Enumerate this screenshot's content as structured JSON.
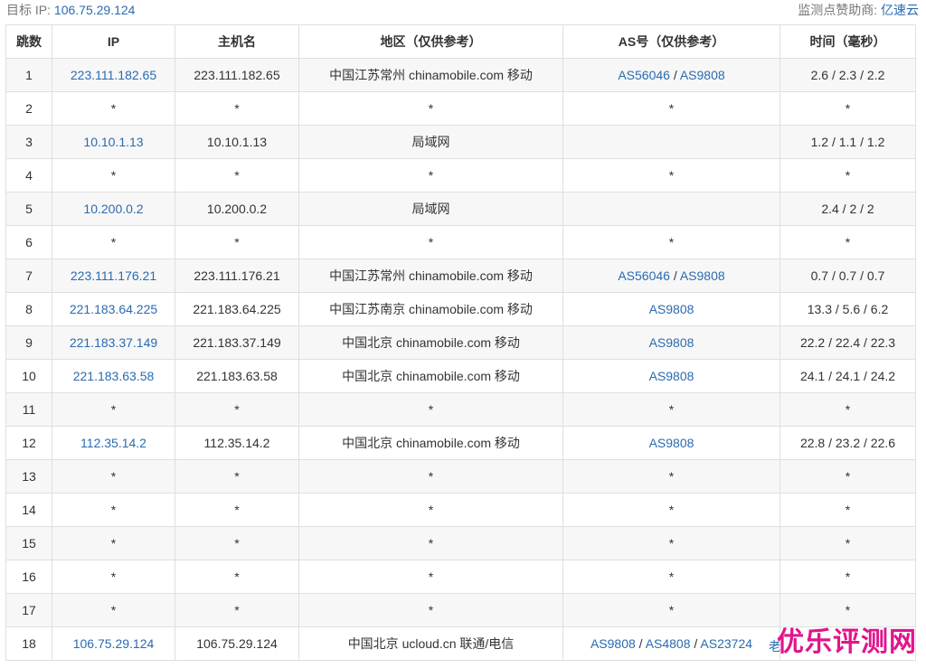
{
  "header": {
    "target_label": "目标 IP:",
    "target_ip": "106.75.29.124",
    "sponsor_label": "监测点赞助商:",
    "sponsor_name": "亿速云"
  },
  "table": {
    "columns": [
      "跳数",
      "IP",
      "主机名",
      "地区（仅供参考）",
      "AS号（仅供参考）",
      "时间（毫秒）"
    ],
    "rows": [
      {
        "hop": "1",
        "ip": "223.111.182.65",
        "host": "223.111.182.65",
        "region": "中国江苏常州 chinamobile.com 移动",
        "as": [
          "AS56046",
          "AS9808"
        ],
        "time": "2.6 / 2.3 / 2.2"
      },
      {
        "hop": "2",
        "ip": "*",
        "host": "*",
        "region": "*",
        "as": [
          "*"
        ],
        "time": "*"
      },
      {
        "hop": "3",
        "ip": "10.10.1.13",
        "host": "10.10.1.13",
        "region": "局域网",
        "as": [],
        "time": "1.2 / 1.1 / 1.2"
      },
      {
        "hop": "4",
        "ip": "*",
        "host": "*",
        "region": "*",
        "as": [
          "*"
        ],
        "time": "*"
      },
      {
        "hop": "5",
        "ip": "10.200.0.2",
        "host": "10.200.0.2",
        "region": "局域网",
        "as": [],
        "time": "2.4 / 2 / 2"
      },
      {
        "hop": "6",
        "ip": "*",
        "host": "*",
        "region": "*",
        "as": [
          "*"
        ],
        "time": "*"
      },
      {
        "hop": "7",
        "ip": "223.111.176.21",
        "host": "223.111.176.21",
        "region": "中国江苏常州 chinamobile.com 移动",
        "as": [
          "AS56046",
          "AS9808"
        ],
        "time": "0.7 / 0.7 / 0.7"
      },
      {
        "hop": "8",
        "ip": "221.183.64.225",
        "host": "221.183.64.225",
        "region": "中国江苏南京 chinamobile.com 移动",
        "as": [
          "AS9808"
        ],
        "time": "13.3 / 5.6 / 6.2"
      },
      {
        "hop": "9",
        "ip": "221.183.37.149",
        "host": "221.183.37.149",
        "region": "中国北京 chinamobile.com 移动",
        "as": [
          "AS9808"
        ],
        "time": "22.2 / 22.4 / 22.3"
      },
      {
        "hop": "10",
        "ip": "221.183.63.58",
        "host": "221.183.63.58",
        "region": "中国北京 chinamobile.com 移动",
        "as": [
          "AS9808"
        ],
        "time": "24.1 / 24.1 / 24.2"
      },
      {
        "hop": "11",
        "ip": "*",
        "host": "*",
        "region": "*",
        "as": [
          "*"
        ],
        "time": "*"
      },
      {
        "hop": "12",
        "ip": "112.35.14.2",
        "host": "112.35.14.2",
        "region": "中国北京 chinamobile.com 移动",
        "as": [
          "AS9808"
        ],
        "time": "22.8 / 23.2 / 22.6"
      },
      {
        "hop": "13",
        "ip": "*",
        "host": "*",
        "region": "*",
        "as": [
          "*"
        ],
        "time": "*"
      },
      {
        "hop": "14",
        "ip": "*",
        "host": "*",
        "region": "*",
        "as": [
          "*"
        ],
        "time": "*"
      },
      {
        "hop": "15",
        "ip": "*",
        "host": "*",
        "region": "*",
        "as": [
          "*"
        ],
        "time": "*"
      },
      {
        "hop": "16",
        "ip": "*",
        "host": "*",
        "region": "*",
        "as": [
          "*"
        ],
        "time": "*"
      },
      {
        "hop": "17",
        "ip": "*",
        "host": "*",
        "region": "*",
        "as": [
          "*"
        ],
        "time": "*"
      },
      {
        "hop": "18",
        "ip": "106.75.29.124",
        "host": "106.75.29.124",
        "region": "中国北京 ucloud.cn 联通/电信",
        "as": [
          "AS9808",
          "AS4808",
          "AS23724"
        ],
        "time": ""
      }
    ]
  },
  "overlay": {
    "partial_link": "老",
    "watermark": "优乐评测网"
  },
  "colors": {
    "link": "#2a6bb0",
    "watermark": "#e0168c",
    "stripe": "#f7f7f7",
    "border": "#dfdfdf"
  }
}
